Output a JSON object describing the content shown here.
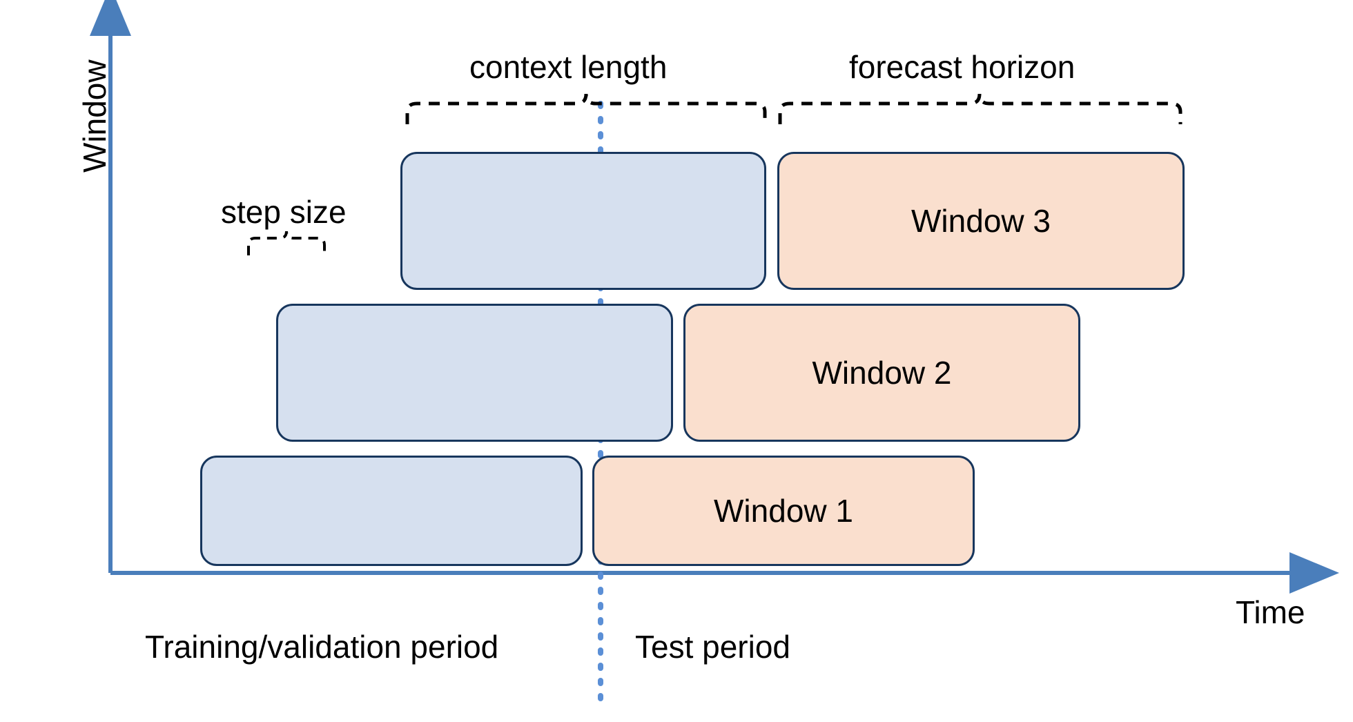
{
  "axes": {
    "x_label": "Time",
    "y_label": "Window"
  },
  "annotations": {
    "context_length": "context length",
    "forecast_horizon": "forecast horizon",
    "step_size": "step size",
    "training_period": "Training/validation period",
    "test_period": "Test period"
  },
  "windows": [
    {
      "label": "Window 1"
    },
    {
      "label": "Window 2"
    },
    {
      "label": "Window 3"
    }
  ],
  "colors": {
    "axis": "#4a7ebb",
    "box_border": "#17365d",
    "context_fill": "#d6e0ef",
    "forecast_fill": "#fadfce",
    "divider": "#5b8fd6"
  },
  "chart_data": {
    "type": "bar",
    "title": "Rolling evaluation windows over time",
    "xlabel": "Time",
    "ylabel": "Window",
    "split_line_x": 5,
    "categories": [
      "Window 1",
      "Window 2",
      "Window 3"
    ],
    "x": [
      0,
      1,
      2,
      3,
      4,
      5,
      6,
      7,
      8,
      9,
      10,
      11
    ],
    "series": [
      {
        "name": "context length",
        "start": [
          1,
          2,
          3
        ],
        "end": [
          5,
          6,
          7
        ]
      },
      {
        "name": "forecast horizon",
        "start": [
          5,
          6,
          7
        ],
        "end": [
          9,
          10,
          11
        ]
      }
    ],
    "step_size": 1,
    "periods": [
      {
        "name": "Training/validation period",
        "x_start": 0,
        "x_end": 5
      },
      {
        "name": "Test period",
        "x_start": 5,
        "x_end": 12
      }
    ],
    "context_length": 4,
    "forecast_horizon": 4
  }
}
